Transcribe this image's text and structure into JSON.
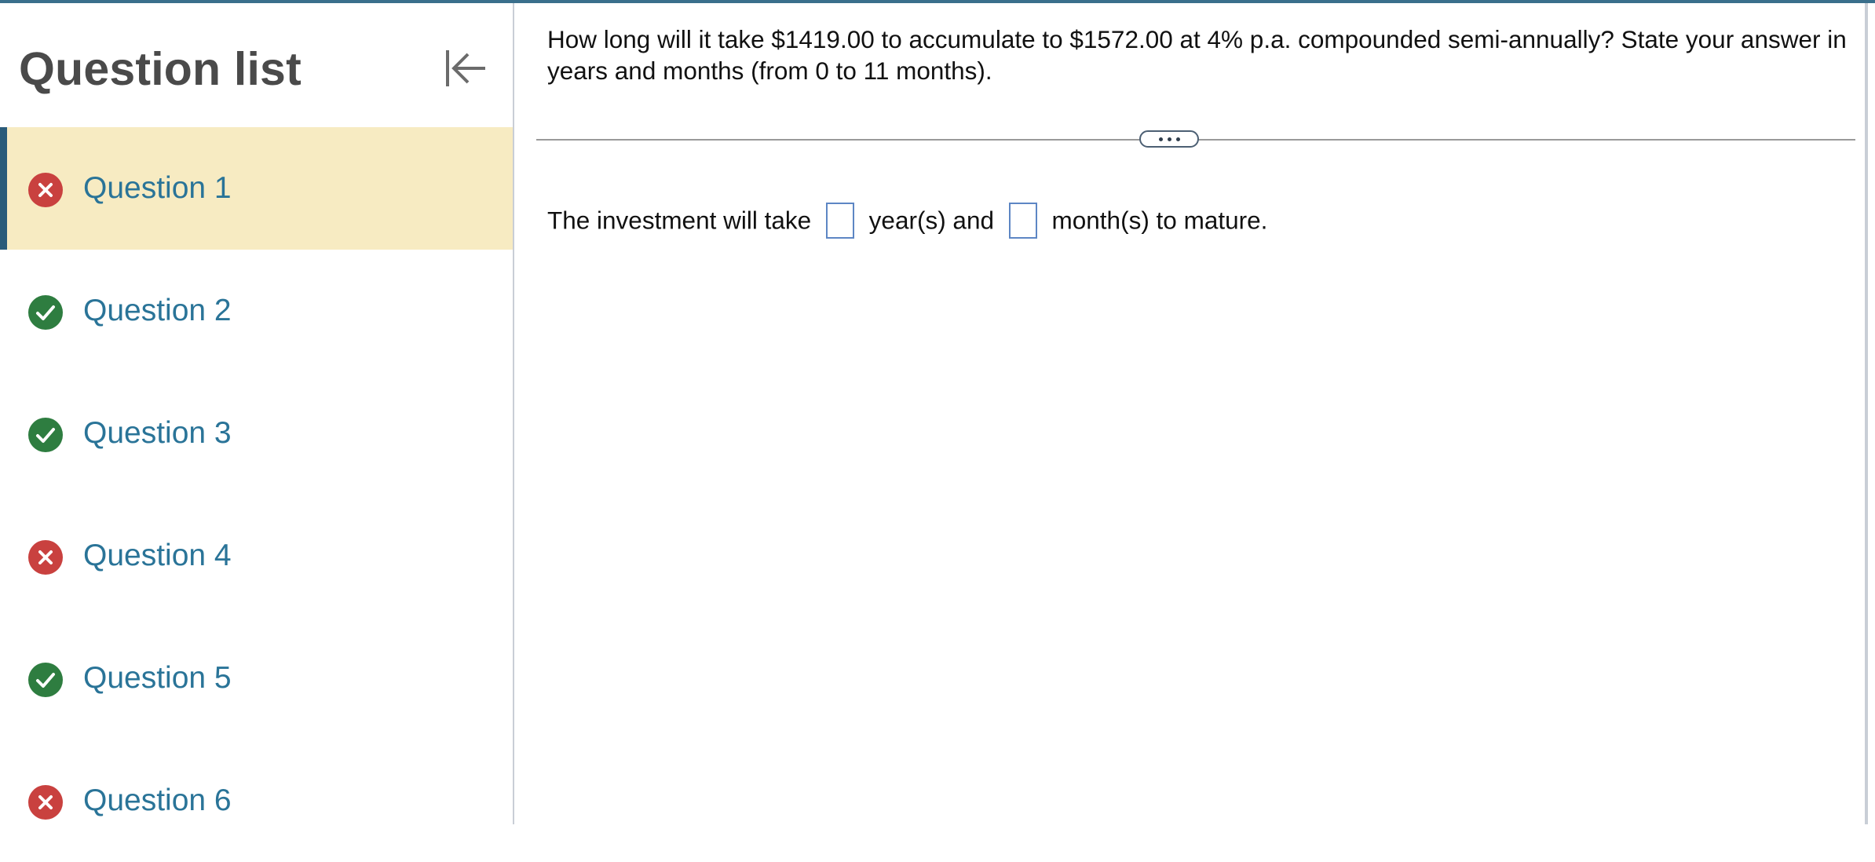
{
  "sidebar": {
    "title": "Question list",
    "collapse_icon": "collapse-left-icon",
    "items": [
      {
        "label": "Question 1",
        "status": "incorrect",
        "active": true
      },
      {
        "label": "Question 2",
        "status": "correct",
        "active": false
      },
      {
        "label": "Question 3",
        "status": "correct",
        "active": false
      },
      {
        "label": "Question 4",
        "status": "incorrect",
        "active": false
      },
      {
        "label": "Question 5",
        "status": "correct",
        "active": false
      },
      {
        "label": "Question 6",
        "status": "incorrect",
        "active": false
      }
    ]
  },
  "main": {
    "prompt": "How long will it take $1419.00 to accumulate to $1572.00 at 4% p.a. compounded semi-annually? State your answer in years and months (from 0 to 11 months).",
    "expand_icon": "more-dots-icon",
    "answer": {
      "part1": "The investment will take",
      "part2": "year(s) and",
      "part3": "month(s) to mature.",
      "years_value": "",
      "months_value": ""
    }
  },
  "colors": {
    "accent": "#2a5b7a",
    "active_bg": "#f7ebc2",
    "link": "#2a7498",
    "correct": "#2e7d40",
    "incorrect": "#c9413f",
    "input_border": "#5d86c4"
  }
}
